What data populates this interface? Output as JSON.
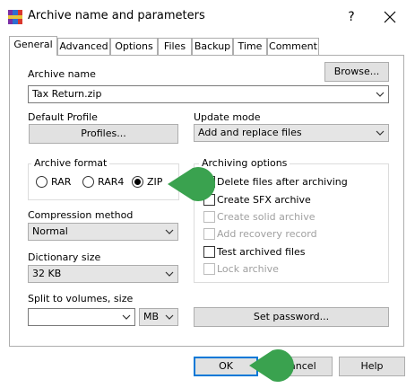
{
  "window": {
    "title": "Archive name and parameters",
    "help_glyph": "?",
    "close_glyph": "✕"
  },
  "tabs": [
    {
      "label": "General",
      "active": true
    },
    {
      "label": "Advanced"
    },
    {
      "label": "Options"
    },
    {
      "label": "Files"
    },
    {
      "label": "Backup"
    },
    {
      "label": "Time"
    },
    {
      "label": "Comment"
    }
  ],
  "general": {
    "archive_name_label": "Archive name",
    "browse_button": "Browse...",
    "archive_name_value": "Tax Return.zip",
    "default_profile_label": "Default Profile",
    "profiles_button": "Profiles...",
    "update_mode_label": "Update mode",
    "update_mode_value": "Add and replace files",
    "archive_format": {
      "title": "Archive format",
      "options": [
        "RAR",
        "RAR4",
        "ZIP"
      ],
      "selected": "ZIP"
    },
    "compression_method_label": "Compression method",
    "compression_method_value": "Normal",
    "dictionary_size_label": "Dictionary size",
    "dictionary_size_value": "32 KB",
    "split_label": "Split to volumes, size",
    "split_value": "",
    "split_unit": "MB",
    "archiving_options": {
      "title": "Archiving options",
      "items": [
        {
          "label": "Delete files after archiving",
          "checked": false,
          "enabled": true
        },
        {
          "label": "Create SFX archive",
          "checked": false,
          "enabled": true
        },
        {
          "label": "Create solid archive",
          "checked": false,
          "enabled": false
        },
        {
          "label": "Add recovery record",
          "checked": false,
          "enabled": false
        },
        {
          "label": "Test archived files",
          "checked": false,
          "enabled": true
        },
        {
          "label": "Lock archive",
          "checked": false,
          "enabled": false
        }
      ]
    },
    "set_password_button": "Set password..."
  },
  "buttons": {
    "ok": "OK",
    "cancel": "Cancel",
    "help": "Help"
  },
  "colors": {
    "pointer": "#3aa24f",
    "button_face": "#e1e1e1",
    "ok_border": "#0078d7"
  }
}
